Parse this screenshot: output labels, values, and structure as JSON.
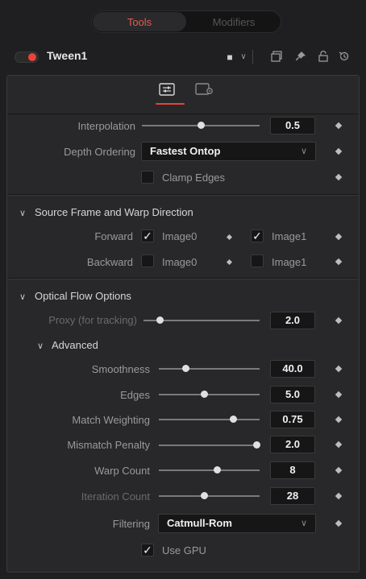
{
  "tabs": {
    "tools": "Tools",
    "modifiers": "Modifiers"
  },
  "node": {
    "title": "Tween1",
    "color_swatch": "■",
    "swatch_chevron": "∨"
  },
  "controls": {
    "interpolation": {
      "label": "Interpolation",
      "value": "0.5",
      "level": 0.5
    },
    "depth_ordering": {
      "label": "Depth Ordering",
      "value": "Fastest Ontop"
    },
    "clamp_edges": {
      "label": "Clamp Edges",
      "checked": false
    }
  },
  "source_frame": {
    "title": "Source Frame and Warp Direction",
    "forward": {
      "label": "Forward",
      "image0": "Image0",
      "image0_checked": true,
      "image1": "Image1",
      "image1_checked": true
    },
    "backward": {
      "label": "Backward",
      "image0": "Image0",
      "image0_checked": false,
      "image1": "Image1",
      "image1_checked": false
    }
  },
  "optical_flow": {
    "title": "Optical Flow Options",
    "proxy": {
      "label": "Proxy (for tracking)",
      "value": "2.0",
      "level": 0.14
    },
    "advanced": {
      "title": "Advanced",
      "smoothness": {
        "label": "Smoothness",
        "value": "40.0",
        "level": 0.27
      },
      "edges": {
        "label": "Edges",
        "value": "5.0",
        "level": 0.45
      },
      "match_weighting": {
        "label": "Match Weighting",
        "value": "0.75",
        "level": 0.74
      },
      "mismatch_penalty": {
        "label": "Mismatch Penalty",
        "value": "2.0",
        "level": 0.97
      },
      "warp_count": {
        "label": "Warp Count",
        "value": "8",
        "level": 0.58
      },
      "iteration_count": {
        "label": "Iteration Count",
        "value": "28",
        "level": 0.45
      },
      "filtering": {
        "label": "Filtering",
        "value": "Catmull-Rom"
      },
      "use_gpu": {
        "label": "Use GPU",
        "checked": true
      }
    }
  },
  "colors": {
    "accent": "#e8433a",
    "panel": "#28282a",
    "background": "#1f1f21"
  }
}
